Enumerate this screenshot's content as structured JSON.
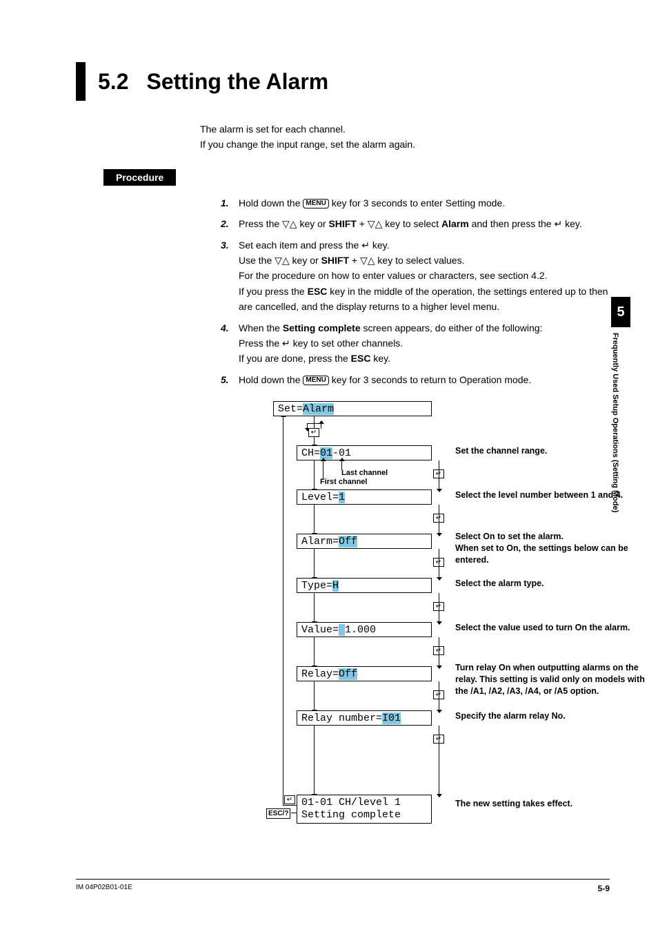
{
  "title": {
    "number": "5.2",
    "text": "Setting the Alarm"
  },
  "intro": {
    "line1": "The alarm is set for each channel.",
    "line2": "If you change the input range, set the alarm again."
  },
  "procedure_label": "Procedure",
  "steps": {
    "s1n": "1.",
    "s1a": "Hold down the ",
    "s1b": " key for 3 seconds to enter Setting mode.",
    "s2n": "2.",
    "s2a": "Press the ▽△ key or ",
    "s2shift": "SHIFT",
    "s2b": " + ▽△ key to select ",
    "s2alarm": "Alarm",
    "s2c": " and then press the ",
    "s2d": " key.",
    "s3n": "3.",
    "s3a": "Set each item and press the ",
    "s3b": " key.",
    "s3c": "Use the ▽△ key or ",
    "s3shift": "SHIFT",
    "s3d": " + ▽△ key to select values.",
    "s3e": "For the procedure on how to enter values or characters, see section 4.2.",
    "s3f": "If you press the ",
    "s3esc": "ESC",
    "s3g": " key in the middle of the operation, the settings entered up to then are cancelled, and the display returns to a higher level menu.",
    "s4n": "4.",
    "s4a": "When the ",
    "s4sc": "Setting complete",
    "s4b": " screen appears, do either of the following:",
    "s4c": "Press the ",
    "s4d": " key to set other channels.",
    "s4e": "If you are done, press the ",
    "s4esc": "ESC",
    "s4f": " key.",
    "s5n": "5.",
    "s5a": "Hold down the ",
    "s5b": " key for 3 seconds to return to Operation mode."
  },
  "menu_key": "MENU",
  "enter_glyph": "↵",
  "flow": {
    "set_pre": "Set=",
    "set_val": "Alarm",
    "ch_pre": "CH=",
    "ch_hl": "01",
    "ch_post": "-01",
    "first_ch": "First channel",
    "last_ch": "Last channel",
    "level_pre": "Level=",
    "level_val": "1",
    "alarm_pre": "Alarm=",
    "alarm_val": "Off",
    "type_pre": "Type=",
    "type_val": "H",
    "value_pre": "Value=",
    "value_hl": " ",
    "value_post": " 1.000",
    "relay_pre": "Relay=",
    "relay_val": "Off",
    "relaynum_pre": "Relay number=",
    "relaynum_val": "I01",
    "complete_l1": "01-01 CH/level 1",
    "complete_l2": "Setting complete",
    "esc": "ESC/?",
    "anno_ch": "Set the channel range.",
    "anno_level": "Select the level number between 1 and 4.",
    "anno_alarm": "Select On to set the alarm.\nWhen set to On, the settings below can be entered.",
    "anno_type": "Select the alarm type.",
    "anno_value": "Select the value used to turn On the alarm.",
    "anno_relay": "Turn relay On when outputting alarms on the relay. This setting is valid only on models with the /A1, /A2, /A3, /A4, or /A5 option.",
    "anno_relaynum": "Specify the alarm relay No.",
    "anno_complete": "The new setting takes effect."
  },
  "side_tab": {
    "num": "5",
    "text": "Frequently Used Setup Operations (Setting Mode)"
  },
  "footer": {
    "left": "IM 04P02B01-01E",
    "right": "5-9"
  }
}
